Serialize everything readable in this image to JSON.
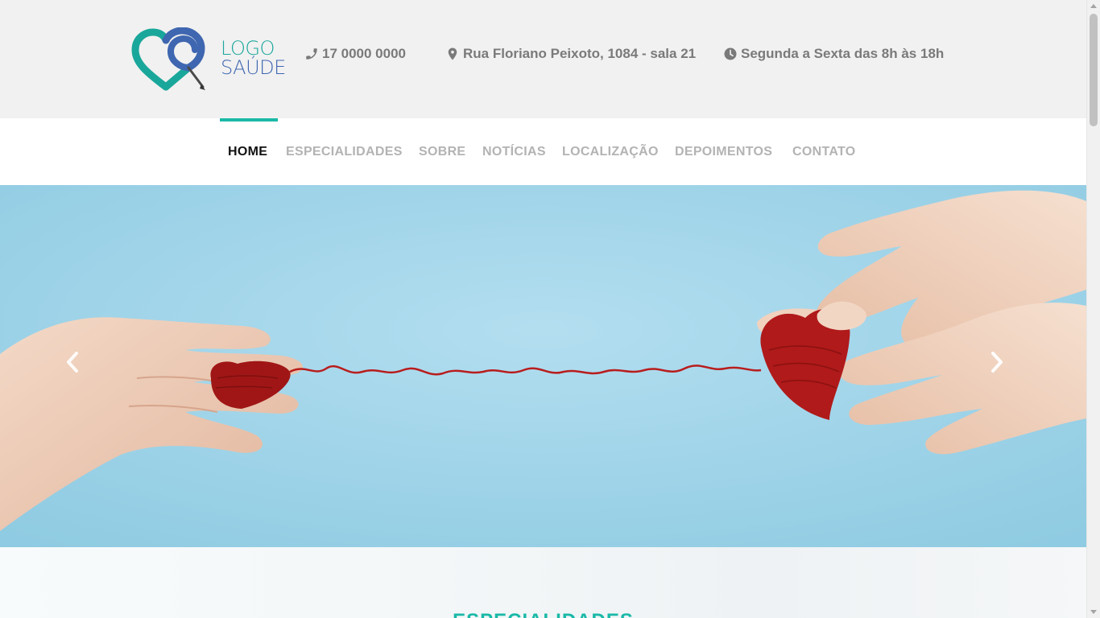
{
  "header": {
    "logo": {
      "line1": "LOGO",
      "line2": "SAÚDE",
      "icon": "heart-pencil-logo"
    },
    "phone": {
      "icon": "phone-icon",
      "text": "17 0000 0000"
    },
    "address": {
      "icon": "map-marker-icon",
      "text": "Rua Floriano Peixoto, 1084 - sala 21"
    },
    "hours": {
      "icon": "clock-icon",
      "text": "Segunda a Sexta das 8h às 18h"
    }
  },
  "nav": {
    "items": [
      {
        "label": "HOME",
        "active": true
      },
      {
        "label": "ESPECIALIDADES",
        "active": false
      },
      {
        "label": "SOBRE",
        "active": false
      },
      {
        "label": "NOTÍCIAS",
        "active": false
      },
      {
        "label": "LOCALIZAÇÃO",
        "active": false
      },
      {
        "label": "DEPOIMENTOS",
        "active": false
      },
      {
        "label": "CONTATO",
        "active": false
      }
    ]
  },
  "hero": {
    "prev_icon": "chevron-left-icon",
    "next_icon": "chevron-right-icon"
  },
  "section": {
    "title": "ESPECIALIDADES"
  },
  "colors": {
    "accent": "#1ab9a7",
    "logo_teal": "#1aa79b",
    "logo_blue": "#3f66b0",
    "header_bg": "#f1f1f1",
    "nav_inactive": "#b3b3b3",
    "hero_bg": "#a6d7e9"
  }
}
